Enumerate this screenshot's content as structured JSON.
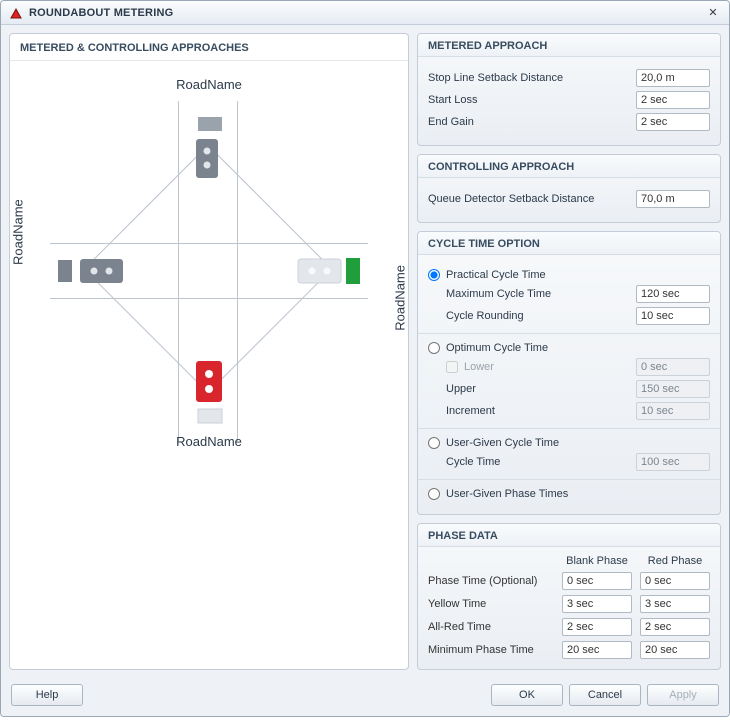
{
  "title": "ROUNDABOUT METERING",
  "left_panel_title": "METERED & CONTROLLING APPROACHES",
  "diagram": {
    "road_top": "RoadName",
    "road_right": "RoadName",
    "road_bottom": "RoadName",
    "road_left": "RoadName"
  },
  "metered_approach": {
    "section_title": "METERED APPROACH",
    "stop_line_label": "Stop Line Setback Distance",
    "stop_line_value": "20,0 m",
    "start_loss_label": "Start Loss",
    "start_loss_value": "2 sec",
    "end_gain_label": "End Gain",
    "end_gain_value": "2 sec"
  },
  "controlling_approach": {
    "section_title": "CONTROLLING APPROACH",
    "queue_det_label": "Queue Detector Setback Distance",
    "queue_det_value": "70,0 m"
  },
  "cycle_time": {
    "section_title": "CYCLE TIME OPTION",
    "practical_label": "Practical Cycle Time",
    "max_cycle_label": "Maximum Cycle Time",
    "max_cycle_value": "120 sec",
    "cycle_rounding_label": "Cycle Rounding",
    "cycle_rounding_value": "10 sec",
    "optimum_label": "Optimum Cycle Time",
    "lower_label": "Lower",
    "lower_value": "0 sec",
    "upper_label": "Upper",
    "upper_value": "150 sec",
    "increment_label": "Increment",
    "increment_value": "10 sec",
    "user_cycle_label": "User-Given Cycle Time",
    "cycle_time_label": "Cycle Time",
    "cycle_time_value": "100 sec",
    "user_phase_label": "User-Given Phase Times"
  },
  "phase_data": {
    "section_title": "PHASE DATA",
    "col_blank": "Blank Phase",
    "col_red": "Red Phase",
    "phase_time_label": "Phase Time (Optional)",
    "phase_time_blank": "0 sec",
    "phase_time_red": "0 sec",
    "yellow_label": "Yellow Time",
    "yellow_blank": "3 sec",
    "yellow_red": "3 sec",
    "allred_label": "All-Red Time",
    "allred_blank": "2 sec",
    "allred_red": "2 sec",
    "min_phase_label": "Minimum Phase Time",
    "min_phase_blank": "20 sec",
    "min_phase_red": "20 sec"
  },
  "buttons": {
    "help": "Help",
    "ok": "OK",
    "cancel": "Cancel",
    "apply": "Apply"
  }
}
